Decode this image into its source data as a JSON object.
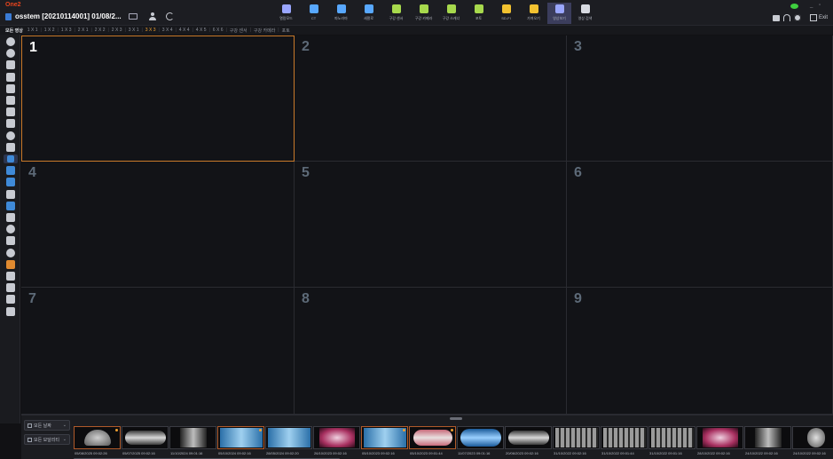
{
  "app": {
    "logo": "One2",
    "patient": "osstem [20210114001] 01/08/2..."
  },
  "modules": [
    {
      "label": "열람모드",
      "icon": "viewer-mode-icon",
      "color": "#9aa6ff"
    },
    {
      "label": "CT",
      "icon": "ct-icon",
      "color": "#58a8ff"
    },
    {
      "label": "파노라마",
      "icon": "panorama-icon",
      "color": "#58a8ff"
    },
    {
      "label": "세팔로",
      "icon": "cephalo-icon",
      "color": "#58a8ff"
    },
    {
      "label": "구강 센서",
      "icon": "intraoral-sensor-icon",
      "color": "#a7d94d"
    },
    {
      "label": "구강 카메라",
      "icon": "intraoral-camera-icon",
      "color": "#a7d94d"
    },
    {
      "label": "구강 스캐너",
      "icon": "intraoral-scanner-icon",
      "color": "#a7d94d"
    },
    {
      "label": "포토",
      "icon": "photo-icon",
      "color": "#a7d94d"
    },
    {
      "label": "SD-FI",
      "icon": "sdfi-folder-icon",
      "color": "#f2c230"
    },
    {
      "label": "가져오기",
      "icon": "import-folder-icon",
      "color": "#f2c230"
    },
    {
      "label": "영상보기",
      "icon": "image-view-icon",
      "color": "#9aa6ff",
      "active": true
    },
    {
      "label": "영상 검색",
      "icon": "image-search-icon",
      "color": "#d8dbe2"
    }
  ],
  "window": {
    "minimize": "_",
    "restore": "▫",
    "exit_label": "Exit"
  },
  "layoutbar": {
    "all_images": "모든 영상",
    "layouts": [
      "1 X 1",
      "1 X 2",
      "1 X 3",
      "2 X 1",
      "2 X 2",
      "2 X 3",
      "3 X 1",
      "3 X 3",
      "3 X 4",
      "4 X 4",
      "4 X 5",
      "6 X 6"
    ],
    "active_layout": "3 X 3",
    "extras": [
      "구강 센서",
      "구강 카메라",
      "포토"
    ]
  },
  "grid": {
    "cells": [
      "1",
      "2",
      "3",
      "4",
      "5",
      "6",
      "7",
      "8",
      "9"
    ],
    "selected": "1"
  },
  "filters": {
    "all_dates": "모든 날짜",
    "all_modalities": "모든 모달리티"
  },
  "thumbnails": [
    {
      "date": "05/08/2025 09:02:26",
      "kind": "ct",
      "flag": true
    },
    {
      "date": "05/07/2025 09:02:16",
      "kind": "pano",
      "flag": false
    },
    {
      "date": "11/10/2024 09:01:16",
      "kind": "ceph",
      "flag": false
    },
    {
      "date": "05/10/2024 09:02:16",
      "kind": "sensor",
      "flag": true
    },
    {
      "date": "28/05/2024 09:02:20",
      "kind": "sensor",
      "flag": false
    },
    {
      "date": "26/10/2023 09:02:16",
      "kind": "camera",
      "flag": false
    },
    {
      "date": "05/10/2023 09:02:16",
      "kind": "sensor",
      "flag": true
    },
    {
      "date": "05/10/2023 09:01:44",
      "kind": "scan",
      "flag": true
    },
    {
      "date": "11/07/2023 09:01:16",
      "kind": "pano-blue",
      "flag": false
    },
    {
      "date": "20/06/2023 09:02:16",
      "kind": "pano",
      "flag": false
    },
    {
      "date": "31/10/2022 09:02:16",
      "kind": "fmx",
      "flag": false
    },
    {
      "date": "31/10/2022 09:01:44",
      "kind": "fmx",
      "flag": false
    },
    {
      "date": "31/10/2022 09:01:16",
      "kind": "fmx",
      "flag": false
    },
    {
      "date": "28/10/2022 09:02:16",
      "kind": "camera",
      "flag": false
    },
    {
      "date": "24/10/2022 09:02:16",
      "kind": "ceph",
      "flag": false
    },
    {
      "date": "24/10/2022 09:02:16",
      "kind": "skull",
      "flag": false
    }
  ],
  "left_tools": [
    {
      "icon": "ai-icon",
      "style": "circle"
    },
    {
      "icon": "info-icon",
      "style": "circle"
    },
    {
      "icon": "rotate-icon",
      "style": ""
    },
    {
      "icon": "flip-icon",
      "style": ""
    },
    {
      "icon": "crop-icon",
      "style": ""
    },
    {
      "icon": "fit-icon",
      "style": ""
    },
    {
      "icon": "pan-icon",
      "style": ""
    },
    {
      "icon": "zoom-icon",
      "style": ""
    },
    {
      "icon": "brightness-icon",
      "style": "circle"
    },
    {
      "icon": "invert-icon",
      "style": ""
    },
    {
      "icon": "pointer-icon",
      "style": "active"
    },
    {
      "icon": "region-icon",
      "style": "blue"
    },
    {
      "icon": "pen-icon",
      "style": "blue"
    },
    {
      "icon": "text-icon",
      "style": ""
    },
    {
      "icon": "measure-icon",
      "style": "blue"
    },
    {
      "icon": "angle-icon",
      "style": ""
    },
    {
      "icon": "circle-draw-icon",
      "style": "circle"
    },
    {
      "icon": "compare-icon",
      "style": ""
    },
    {
      "icon": "sphere-icon",
      "style": "circle"
    },
    {
      "icon": "implant-icon",
      "style": "orange"
    },
    {
      "icon": "tooth-icon",
      "style": ""
    },
    {
      "icon": "grid-icon",
      "style": ""
    },
    {
      "icon": "export-icon",
      "style": ""
    },
    {
      "icon": "print-icon",
      "style": ""
    }
  ]
}
